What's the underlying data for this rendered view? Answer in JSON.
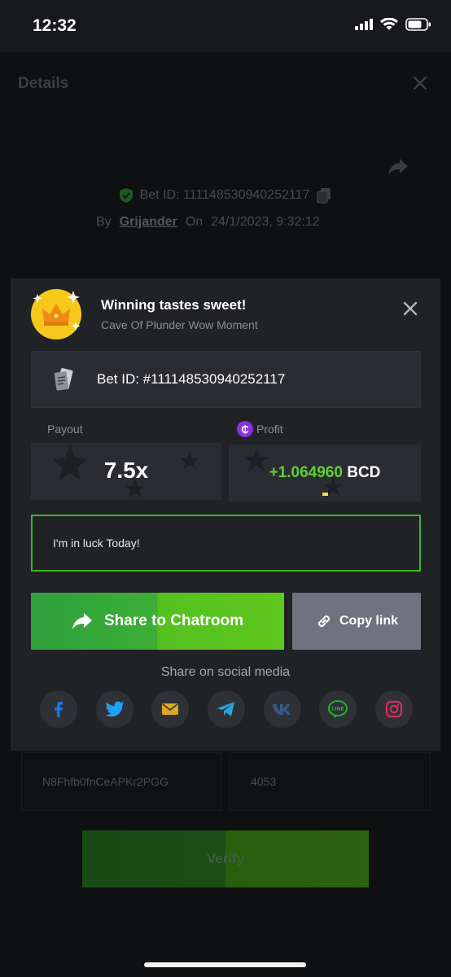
{
  "status_bar": {
    "time": "12:32"
  },
  "background_page": {
    "title": "Details",
    "bet_id_line": "Bet ID: 111148530940252117",
    "by_label": "By",
    "username": "Grijander",
    "on_label": "On",
    "date": "24/1/2023, 9:32:12",
    "seed_value": "N8Fhfb0fnCeAPKr2PGG",
    "nonce_value": "4053",
    "verify_label": "Verify"
  },
  "modal": {
    "title": "Winning tastes sweet!",
    "subtitle": "Cave Of Plunder Wow Moment",
    "bet_id": "Bet ID: #111148530940252117",
    "payout_label": "Payout",
    "payout_value": "7.5x",
    "profit_label": "Profit",
    "profit_amount": "+1.064960",
    "profit_currency": "BCD",
    "coin_symbol": "₵",
    "message": "I'm in luck Today!",
    "share_button": "Share to Chatroom",
    "copy_button": "Copy link",
    "social_label": "Share on social media",
    "social": [
      {
        "name": "facebook",
        "glyph": "f",
        "color": "#1877f2"
      },
      {
        "name": "twitter",
        "color": "#1da1f2"
      },
      {
        "name": "email",
        "color": "#d7a927"
      },
      {
        "name": "telegram",
        "color": "#2aa3d9"
      },
      {
        "name": "vk",
        "glyph": "VK",
        "color": "#3a5a88"
      },
      {
        "name": "line",
        "glyph": "LINE",
        "color": "#23b52f"
      },
      {
        "name": "instagram",
        "color": "#d3315f"
      }
    ]
  },
  "colors": {
    "accent_green": "#5fd038",
    "modal_bg": "#212226",
    "panel_bg": "#2b2c31",
    "coin_purple": "#8c2fe0"
  }
}
